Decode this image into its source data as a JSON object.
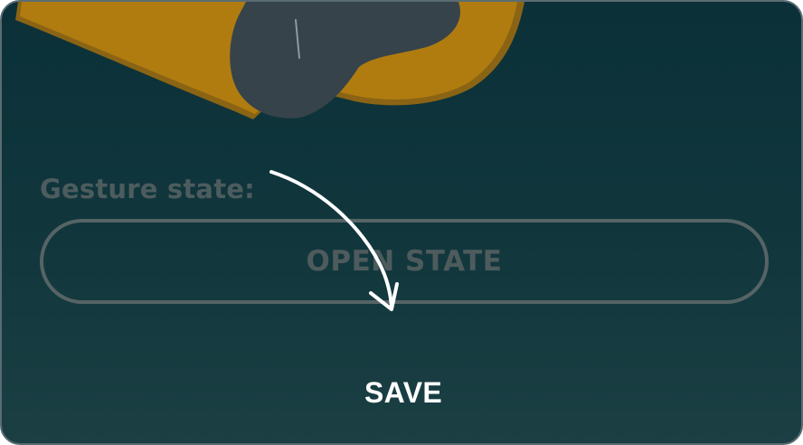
{
  "gesture": {
    "label": "Gesture state:",
    "state_value": "OPEN STATE"
  },
  "actions": {
    "save_label": "SAVE"
  },
  "colors": {
    "background_top": "#0b3038",
    "background_bottom": "#1b3f43",
    "muted_text": "#4e5b5c",
    "illustration_yellow": "#c0840f",
    "illustration_gray": "#36434a",
    "save_text": "#ffffff"
  },
  "icons": {
    "hint_arrow": "curved-arrow-down-icon"
  }
}
